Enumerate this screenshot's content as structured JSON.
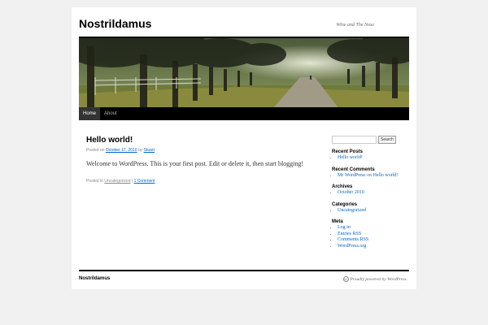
{
  "site": {
    "title": "Nostrildamus",
    "description": "Wine and The Nose"
  },
  "nav": {
    "items": [
      {
        "label": "Home"
      },
      {
        "label": "About"
      }
    ]
  },
  "post": {
    "title": "Hello world!",
    "meta_posted_on": "Posted on",
    "date": "October 17, 2010",
    "meta_by": "by",
    "author": "Stuart",
    "content": "Welcome to WordPress. This is your first post. Edit or delete it, then start blogging!",
    "footer_posted_in": "Posted in",
    "category": "Uncategorized",
    "separator": "|",
    "comments": "1 Comment"
  },
  "sidebar": {
    "search_button": "Search",
    "recent_posts": {
      "title": "Recent Posts",
      "items": [
        "Hello world!"
      ]
    },
    "recent_comments": {
      "title": "Recent Comments",
      "author": "Mr WordPress",
      "on": "on",
      "post": "Hello world!"
    },
    "archives": {
      "title": "Archives",
      "items": [
        "October 2010"
      ]
    },
    "categories": {
      "title": "Categories",
      "items": [
        "Uncategorized"
      ]
    },
    "meta": {
      "title": "Meta",
      "items": [
        "Log in",
        "Entries RSS",
        "Comments RSS",
        "WordPress.org"
      ]
    }
  },
  "footer": {
    "site_name": "Nostrildamus",
    "powered": "Proudly powered by WordPress."
  },
  "colors": {
    "link": "#0066cc",
    "nav_bg": "#000000",
    "page_bg": "#f1f1f1"
  }
}
